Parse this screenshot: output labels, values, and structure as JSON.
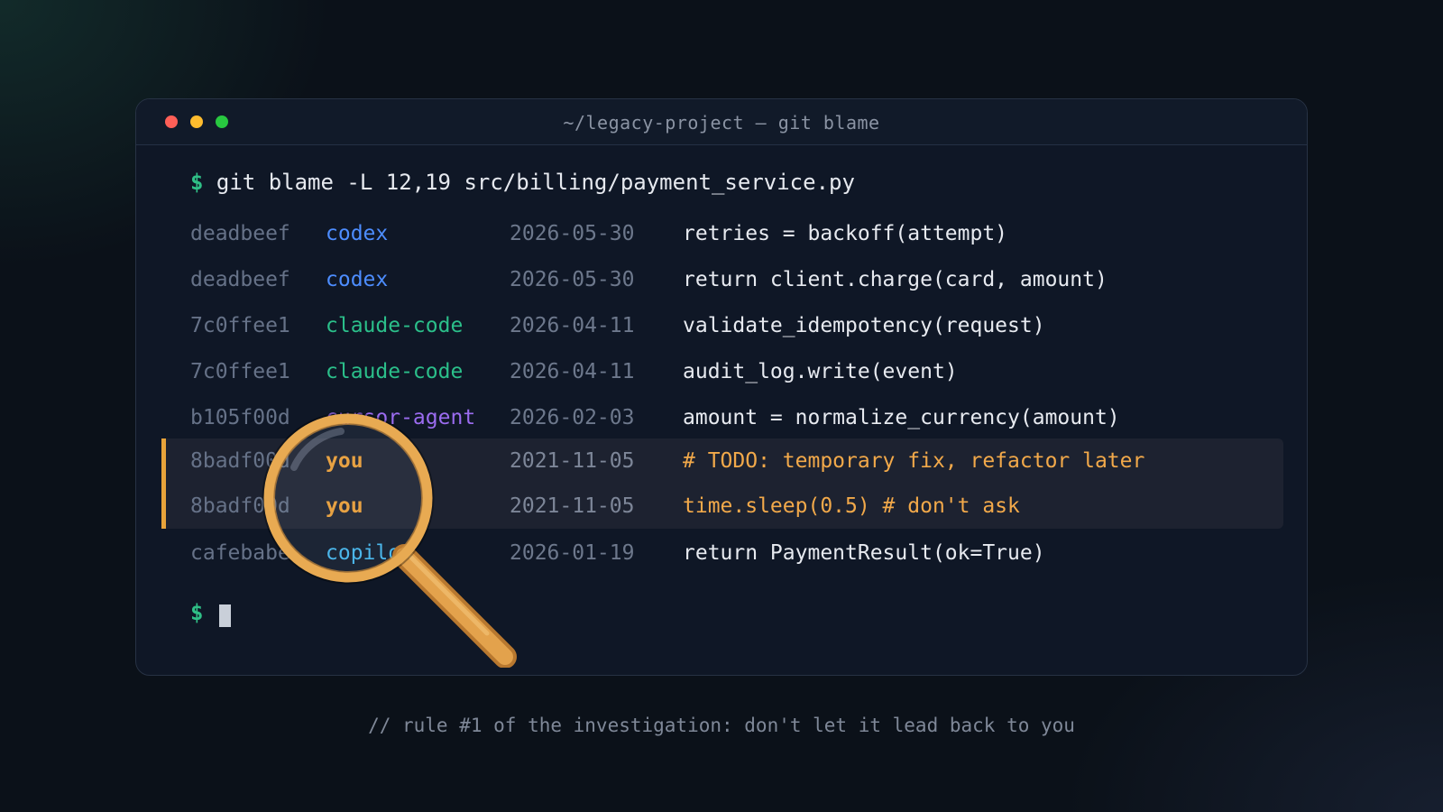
{
  "window": {
    "title": "~/legacy-project — git blame",
    "prompt_symbol": "$",
    "command": "git blame -L 12,19 src/billing/payment_service.py"
  },
  "colors": {
    "prompt": "#2fbf86",
    "codex": "#4d8dff",
    "claude-code": "#2bbf8a",
    "cursor-agent": "#9b6cf0",
    "you": "#f2a236",
    "copilot": "#43b8f0",
    "highlight_bar": "#e8a33a"
  },
  "blame_rows": [
    {
      "hash": "deadbeef",
      "author": "codex",
      "date": "2026-05-30",
      "code": "retries = backoff(attempt)"
    },
    {
      "hash": "deadbeef",
      "author": "codex",
      "date": "2026-05-30",
      "code": "return client.charge(card, amount)"
    },
    {
      "hash": "7c0ffee1",
      "author": "claude-code",
      "date": "2026-04-11",
      "code": "validate_idempotency(request)"
    },
    {
      "hash": "7c0ffee1",
      "author": "claude-code",
      "date": "2026-04-11",
      "code": "audit_log.write(event)"
    },
    {
      "hash": "b105f00d",
      "author": "cursor-agent",
      "date": "2026-02-03",
      "code": "amount = normalize_currency(amount)"
    },
    {
      "hash": "8badf00d",
      "author": "you",
      "date": "2021-11-05",
      "code": "# TODO: temporary fix, refactor later"
    },
    {
      "hash": "8badf00d",
      "author": "you",
      "date": "2021-11-05",
      "code": "time.sleep(0.5) # don't ask"
    },
    {
      "hash": "cafebabe",
      "author": "copilot",
      "date": "2026-01-19",
      "code": "return PaymentResult(ok=True)"
    }
  ],
  "icons": {
    "magnifier": "magnifying-glass-icon"
  },
  "footer": {
    "caption": "// rule #1 of the investigation: don't let it lead back to you"
  }
}
